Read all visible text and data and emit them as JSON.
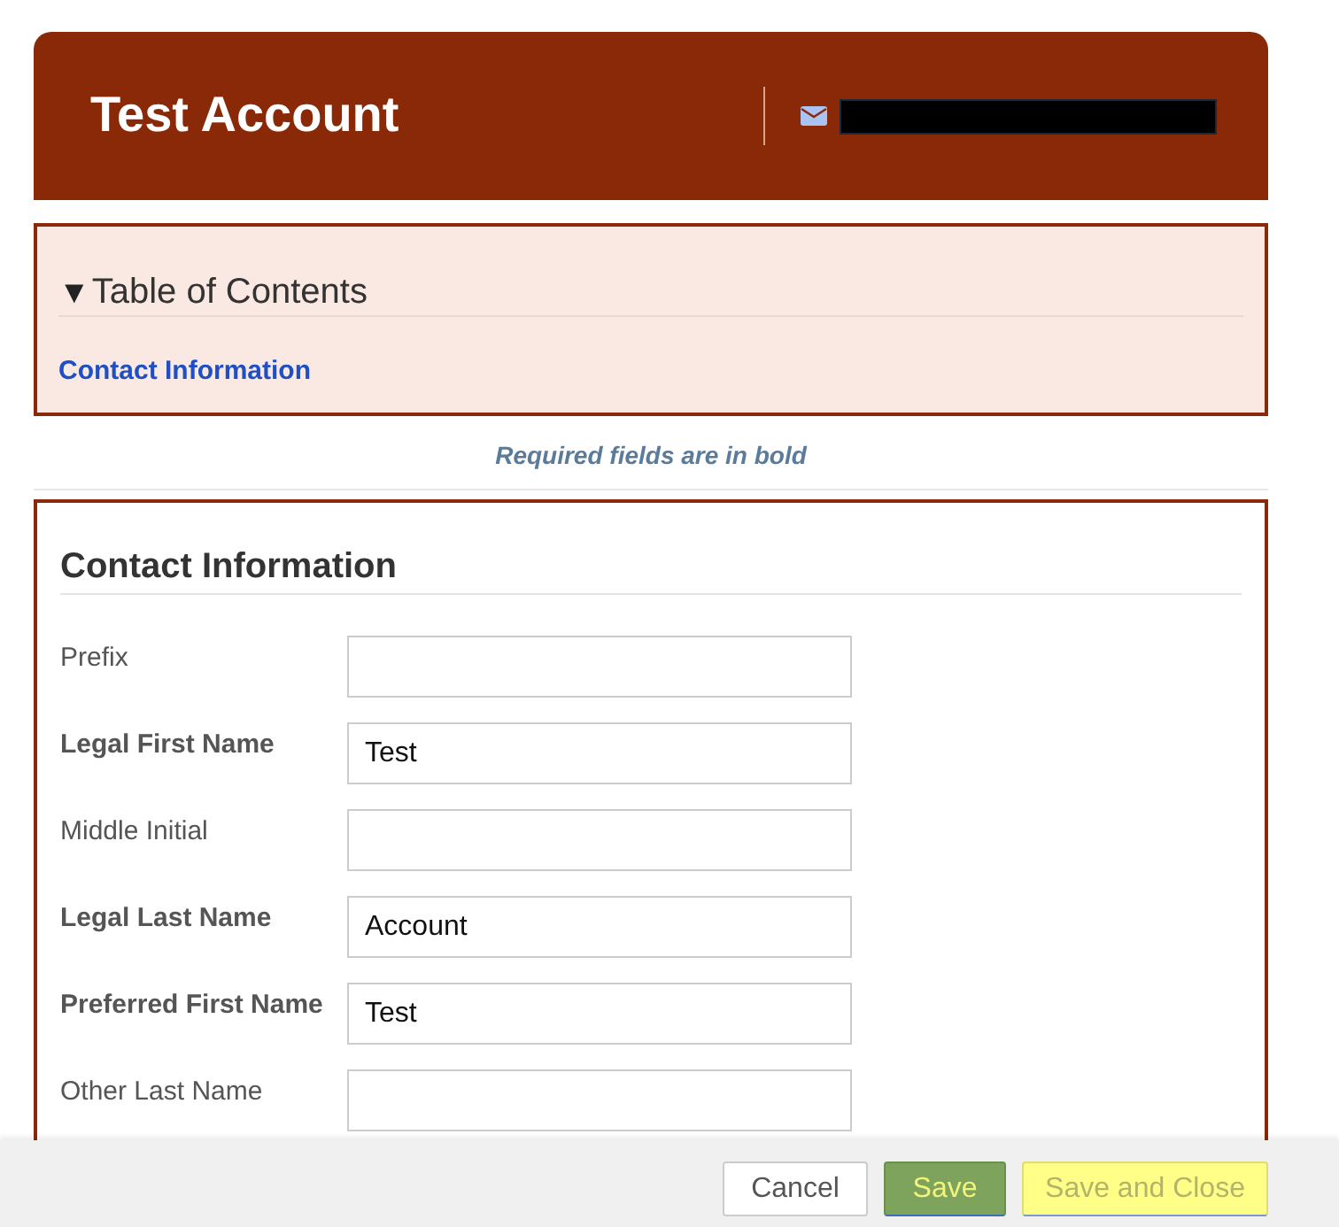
{
  "header": {
    "title": "Test Account"
  },
  "toc": {
    "toggle_icon": "▼",
    "title": "Table of Contents",
    "expanded": true,
    "links": [
      "Contact Information"
    ]
  },
  "required_note": "Required fields are in bold",
  "section": {
    "title": "Contact Information",
    "fields": [
      {
        "label": "Prefix",
        "required": false
      },
      {
        "label": "Legal First Name",
        "required": true,
        "value": "Test"
      },
      {
        "label": "Middle Initial",
        "required": false
      },
      {
        "label": "Legal Last Name",
        "required": true,
        "value": "Account"
      },
      {
        "label": "Preferred First Name",
        "required": true,
        "value": "Test"
      },
      {
        "label": "Other Last Name",
        "required": false
      }
    ]
  },
  "footer_buttons": [
    {
      "label": "Cancel",
      "kind": "default"
    },
    {
      "label": "Save",
      "kind": "primary"
    },
    {
      "label": "Save and Close",
      "kind": "highlight"
    }
  ]
}
